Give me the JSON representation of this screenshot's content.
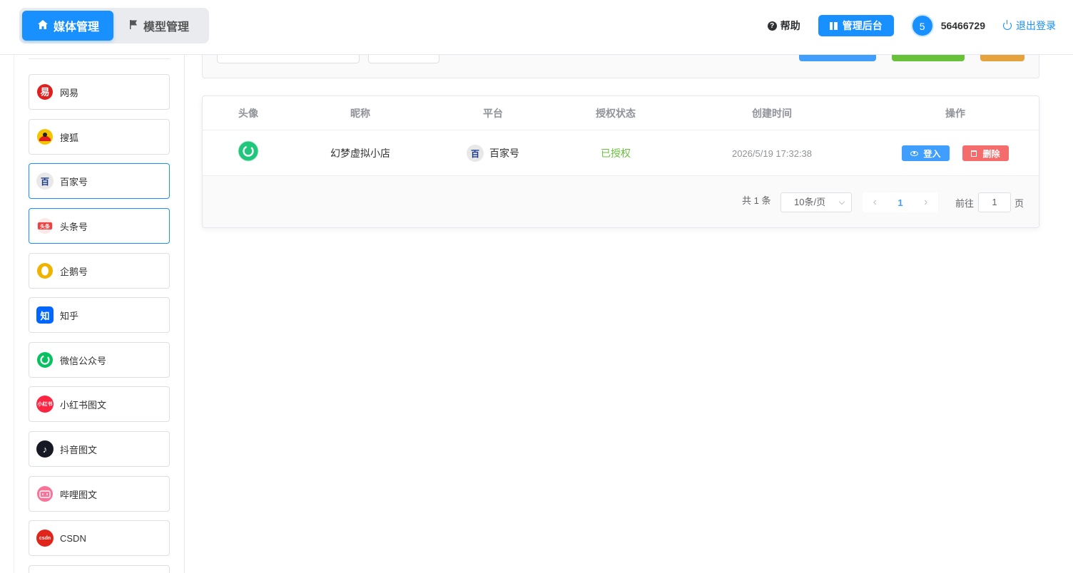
{
  "header": {
    "tabs": [
      {
        "label": "媒体管理",
        "icon": "home-icon",
        "active": true
      },
      {
        "label": "模型管理",
        "icon": "flag-icon",
        "active": false
      }
    ],
    "help_label": "帮助",
    "admin_label": "管理后台",
    "avatar_text": "5",
    "user_id": "56466729",
    "logout_label": "退出登录"
  },
  "sidebar": {
    "items": [
      {
        "label": "网易",
        "icon": "netease-icon",
        "color": "#e02020",
        "glyph": "易"
      },
      {
        "label": "搜狐",
        "icon": "sohu-icon",
        "color": "#f5c400",
        "glyph": ""
      },
      {
        "label": "百家号",
        "icon": "baijiahao-icon",
        "color": "#e8e8e8",
        "glyph": "百"
      },
      {
        "label": "头条号",
        "icon": "toutiao-icon",
        "color": "#f04142",
        "glyph": "头条"
      },
      {
        "label": "企鹅号",
        "icon": "qie-icon",
        "color": "#f0b300",
        "glyph": ""
      },
      {
        "label": "知乎",
        "icon": "zhihu-icon",
        "color": "#0066ff",
        "glyph": "知"
      },
      {
        "label": "微信公众号",
        "icon": "wechat-icon",
        "color": "#07c160",
        "glyph": ""
      },
      {
        "label": "小红书图文",
        "icon": "xiaohongshu-icon",
        "color": "#ff2442",
        "glyph": "小红书"
      },
      {
        "label": "抖音图文",
        "icon": "douyin-icon",
        "color": "#161823",
        "glyph": "♪"
      },
      {
        "label": "哔哩图文",
        "icon": "bilibili-icon",
        "color": "#fb7299",
        "glyph": "bili"
      },
      {
        "label": "CSDN",
        "icon": "csdn-icon",
        "color": "#e1251b",
        "glyph": "csdn"
      }
    ]
  },
  "table": {
    "columns": [
      "头像",
      "昵称",
      "平台",
      "授权状态",
      "创建时间",
      "操作"
    ],
    "rows": [
      {
        "nickname": "幻梦虚拟小店",
        "platform": "百家号",
        "status": "已授权",
        "created": "2026/5/19 17:32:38",
        "login_label": "登入",
        "delete_label": "删除"
      }
    ]
  },
  "pagination": {
    "total": "共 1 条",
    "page_size": "10条/页",
    "current": "1",
    "goto_prefix": "前往",
    "goto_value": "1",
    "goto_suffix": "页"
  }
}
